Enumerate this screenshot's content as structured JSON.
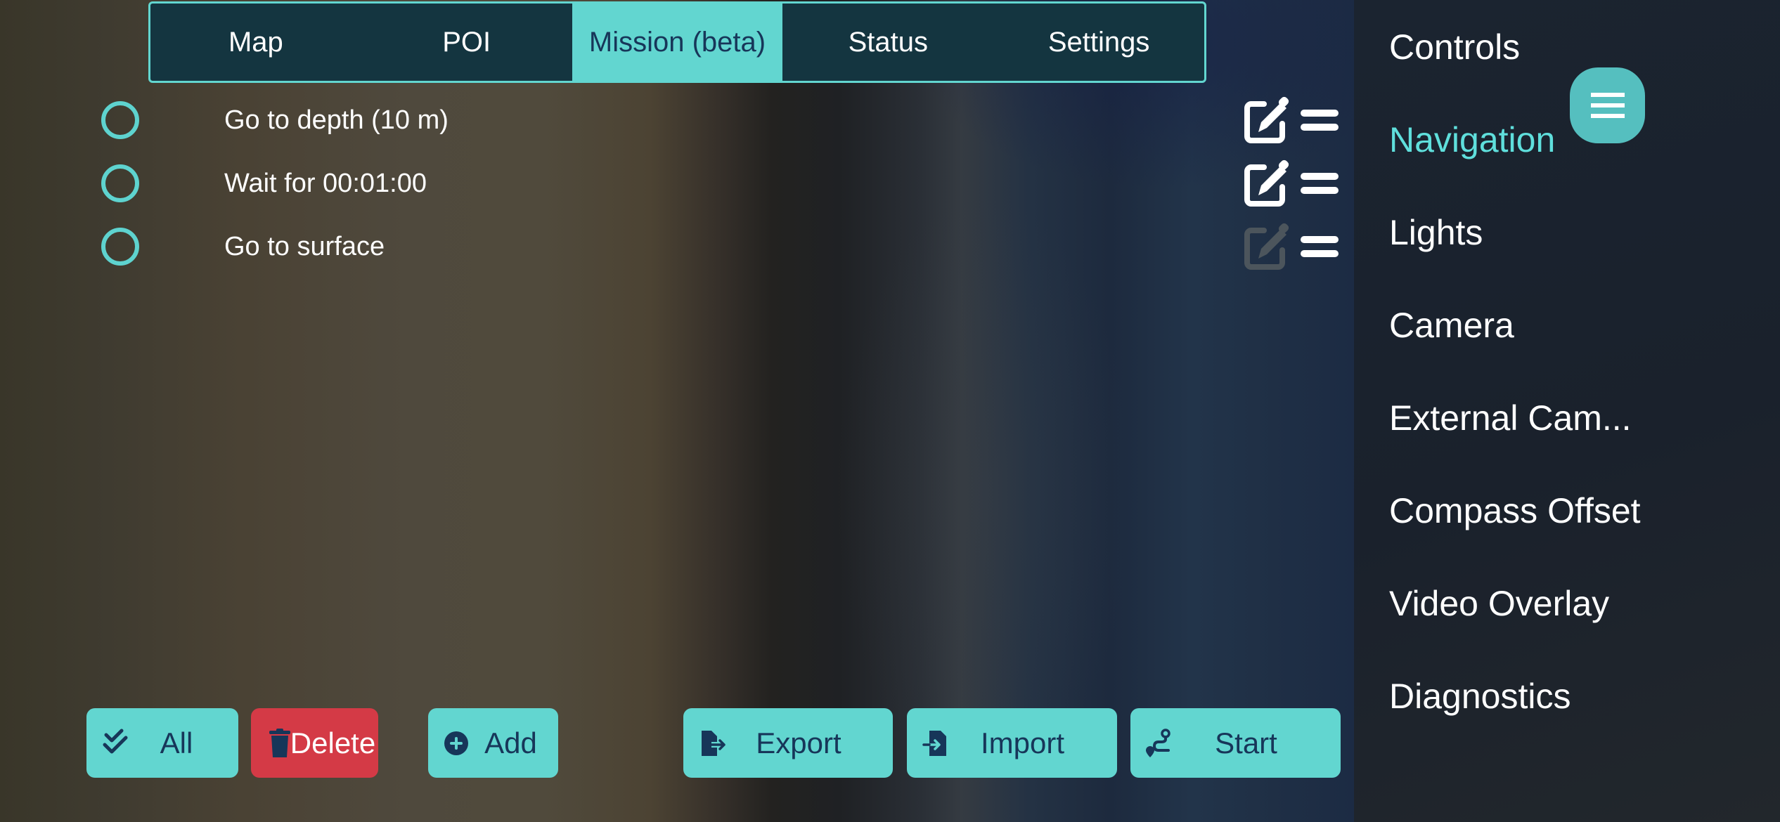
{
  "tabs": [
    {
      "label": "Map",
      "active": false
    },
    {
      "label": "POI",
      "active": false
    },
    {
      "label": "Mission (beta)",
      "active": true
    },
    {
      "label": "Status",
      "active": false
    },
    {
      "label": "Settings",
      "active": false
    }
  ],
  "mission": {
    "items": [
      {
        "label": "Go to depth (10 m)",
        "selected": false,
        "editable": true
      },
      {
        "label": "Wait for 00:01:00",
        "selected": false,
        "editable": true
      },
      {
        "label": "Go to surface",
        "selected": false,
        "editable": false
      }
    ],
    "icons": {
      "select": "radio-circle-icon",
      "edit": "edit-square-pencil-icon",
      "reorder": "drag-handle-icon"
    }
  },
  "buttons": {
    "select_all": {
      "label": "All",
      "icon": "double-check-icon"
    },
    "delete": {
      "label": "Delete",
      "icon": "trash-icon"
    },
    "add": {
      "label": "Add",
      "icon": "plus-circle-icon"
    },
    "export": {
      "label": "Export",
      "icon": "file-export-icon"
    },
    "import": {
      "label": "Import",
      "icon": "file-import-icon"
    },
    "start": {
      "label": "Start",
      "icon": "route-icon"
    }
  },
  "sidebar": {
    "items": [
      {
        "label": "Controls",
        "active": false
      },
      {
        "label": "Navigation",
        "active": true
      },
      {
        "label": "Lights",
        "active": false
      },
      {
        "label": "Camera",
        "active": false
      },
      {
        "label": "External Cam...",
        "active": false
      },
      {
        "label": "Compass Offset",
        "active": false
      },
      {
        "label": "Video Overlay",
        "active": false
      },
      {
        "label": "Diagnostics",
        "active": false
      }
    ],
    "menu_icon": "hamburger-menu-icon"
  },
  "colors": {
    "accent": "#62d6d0",
    "accent_text": "#173659",
    "tab_bg": "#143540",
    "danger": "#d43a46",
    "sidebar_active": "#5fdfdc",
    "sidebar_bg": "#1b2430"
  }
}
